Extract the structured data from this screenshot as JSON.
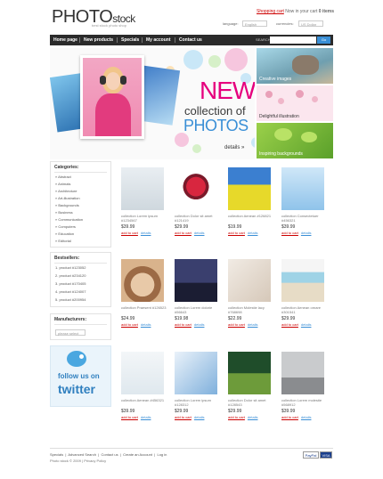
{
  "header": {
    "logo_big": "PHOTO",
    "logo_small": "stock",
    "tagline": "best stock photo shop",
    "cart_link": "Shopping cart",
    "cart_status": "Now in your cart",
    "cart_count": "0 items",
    "language_label": "language:",
    "language_value": "English",
    "currency_label": "currencies:",
    "currency_value": "US Dollar"
  },
  "nav": {
    "items": [
      "Home page",
      "New products",
      "Specials",
      "My account",
      "Contact us"
    ],
    "search_label": "SEARCH:",
    "search_button": "Go"
  },
  "banner": {
    "headline": "NEW",
    "line2": "collection of",
    "line3": "PHOTOS",
    "details": "details »"
  },
  "thumbs": [
    "Creative images",
    "Delightful illustration",
    "Inspiring backgrounds"
  ],
  "categories": {
    "title": "Categories:",
    "items": [
      "Abstract",
      "Animals",
      "Architecture",
      "Art-illustration",
      "Backgrounds",
      "Business",
      "Communication",
      "Computers",
      "Education",
      "Editorial"
    ]
  },
  "bestsellers": {
    "title": "Bestsellers:",
    "items": [
      "1. product #123052",
      "2. product #234120",
      "3. product #170405",
      "4. product #124007",
      "5. product #200954"
    ]
  },
  "manufacturers": {
    "title": "Manufacturers:",
    "select_value": "please select"
  },
  "twitter": {
    "line1": "follow us on",
    "line2": "twitter"
  },
  "products": [
    {
      "name": "collection Lorem ipsum #1234567",
      "price": "$39.99",
      "cart": "add to cart",
      "details": "details",
      "img": "woman"
    },
    {
      "name": "collection Dolor sit amet #121419",
      "price": "$29.99",
      "cart": "add to cart",
      "details": "details",
      "img": "flower"
    },
    {
      "name": "collection Aenean #126821",
      "price": "$19.99",
      "cart": "add to cart",
      "details": "details",
      "img": "field"
    },
    {
      "name": "collection Consectetuer #456321",
      "price": "$39.99",
      "cart": "add to cart",
      "details": "details",
      "img": "yoga"
    },
    {
      "name": "collection Praesent #126523",
      "price": "$24.99",
      "cart": "add to cart",
      "details": "details",
      "img": "spa"
    },
    {
      "name": "collection Lorem dolorie #56643",
      "price": "$19.98",
      "cart": "add to cart",
      "details": "details",
      "img": "city"
    },
    {
      "name": "collection Molestie lacy #768698",
      "price": "$22.99",
      "cart": "add to cart",
      "details": "details",
      "img": "brush"
    },
    {
      "name": "collection Aenean ornare #301541",
      "price": "$29.99",
      "cart": "add to cart",
      "details": "details",
      "img": "beach"
    },
    {
      "name": "collection Aenean #456321",
      "price": "$39.99",
      "cart": "add to cart",
      "details": "details",
      "img": "doctor"
    },
    {
      "name": "collection Lorem ipsum #128312",
      "price": "$29.99",
      "cart": "add to cart",
      "details": "details",
      "img": "chart"
    },
    {
      "name": "collection Dolor sit amet #128543",
      "price": "$29.99",
      "cart": "add to cart",
      "details": "details",
      "img": "road"
    },
    {
      "name": "collection Lorem molestie #568912",
      "price": "$39.99",
      "cart": "add to cart",
      "details": "details",
      "img": "room"
    }
  ],
  "footer": {
    "links": [
      "Specials",
      "Advanced Search",
      "Contact us",
      "Create an Account",
      "Log in"
    ],
    "copyright": "Photo stock © 2009 | Privacy Policy",
    "pay1": "PayPal",
    "pay2": "VISA"
  }
}
